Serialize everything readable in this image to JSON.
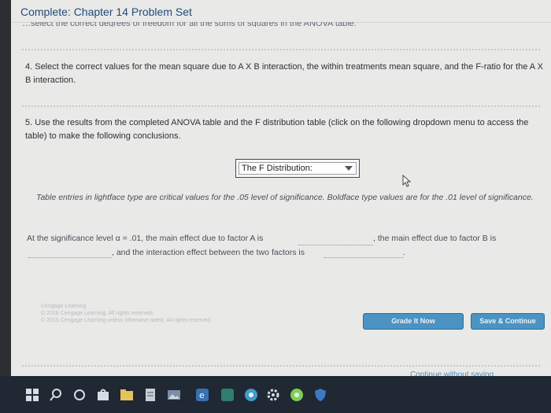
{
  "window": {
    "title": "Complete: Chapter 14 Problem Set"
  },
  "cut_line": "…select the correct degrees of freedom for all the sums of squares in the ANOVA table.",
  "question4": {
    "text": "4. Select the correct values for the mean square due to A X B interaction, the within treatments mean square, and the F-ratio for the A X B interaction."
  },
  "question5": {
    "text": "5. Use the results from the completed ANOVA table and the F distribution table (click on the following dropdown menu to access the table) to make the following conclusions."
  },
  "dropdown": {
    "label": "The F Distribution:"
  },
  "table_note": "Table entries in lightface type are critical values for the .05 level of significance. Boldface type values are for the .01 level of significance.",
  "conclusion": {
    "part1": "At the significance level α = .01, the main effect due to factor A is",
    "part2": ", the main effect due to factor B is",
    "part3": ", and the interaction effect between the two factors is",
    "part4": "."
  },
  "faded_copyright": [
    "Cengage Learning",
    "© 2018 Cengage Learning. All rights reserved.",
    "© 2015 Cengage Learning unless otherwise noted. All rights reserved."
  ],
  "buttons": {
    "grade": "Grade It Now",
    "save": "Save & Continue"
  },
  "continue_link": "Continue without saving",
  "colors": {
    "accent": "#4b93c2",
    "title": "#234c7a",
    "taskbar": "#1f2833"
  },
  "taskbar": {
    "icons": [
      "windows-start-icon",
      "search-icon",
      "cortana-icon",
      "store-icon",
      "file-explorer-icon",
      "document-icon",
      "photos-icon",
      "edge-icon",
      "chrome-icon",
      "settings-icon",
      "green-app-icon",
      "shield-icon"
    ]
  }
}
